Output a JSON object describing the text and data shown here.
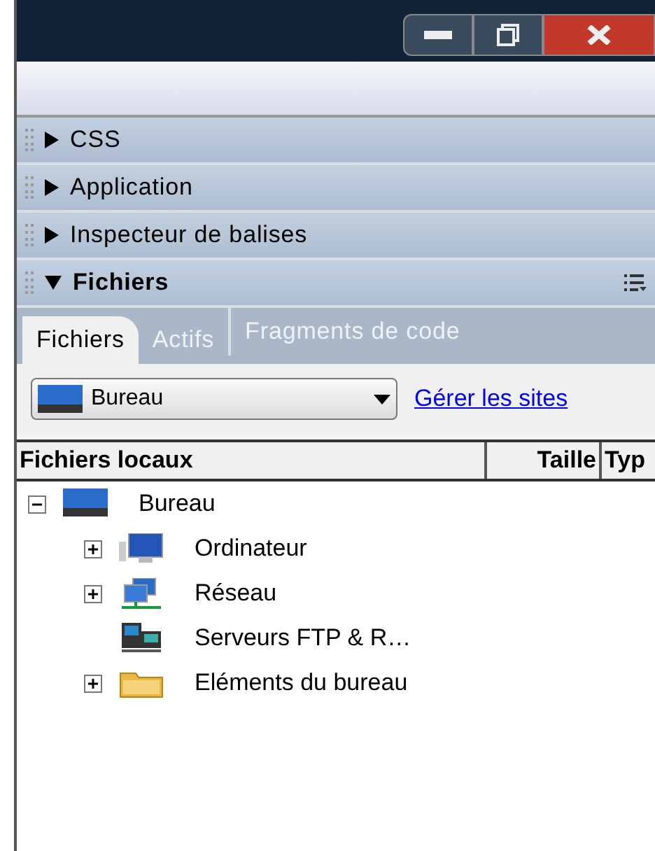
{
  "panels": [
    {
      "title": "CSS",
      "expanded": false
    },
    {
      "title": "Application",
      "expanded": false
    },
    {
      "title": "Inspecteur de balises",
      "expanded": false
    },
    {
      "title": "Fichiers",
      "expanded": true
    }
  ],
  "tabs": [
    {
      "label": "Fichiers",
      "selected": true
    },
    {
      "label": "Actifs",
      "selected": false
    },
    {
      "label": "Fragments de code",
      "selected": false
    }
  ],
  "site_dropdown": {
    "value": "Bureau"
  },
  "manage_link": "Gérer les sites",
  "columns": [
    "Fichiers locaux",
    "Taille",
    "Typ"
  ],
  "tree": [
    {
      "label": "Bureau",
      "kind": "desktop",
      "expanded": true,
      "children": [
        {
          "label": "Ordinateur",
          "kind": "computer",
          "expanded": false,
          "has_children": true
        },
        {
          "label": "Réseau",
          "kind": "network",
          "expanded": false,
          "has_children": true
        },
        {
          "label": "Serveurs FTP & R…",
          "kind": "servers",
          "has_children": false
        },
        {
          "label": "Eléments du bureau",
          "kind": "folder",
          "expanded": false,
          "has_children": true
        }
      ]
    }
  ]
}
